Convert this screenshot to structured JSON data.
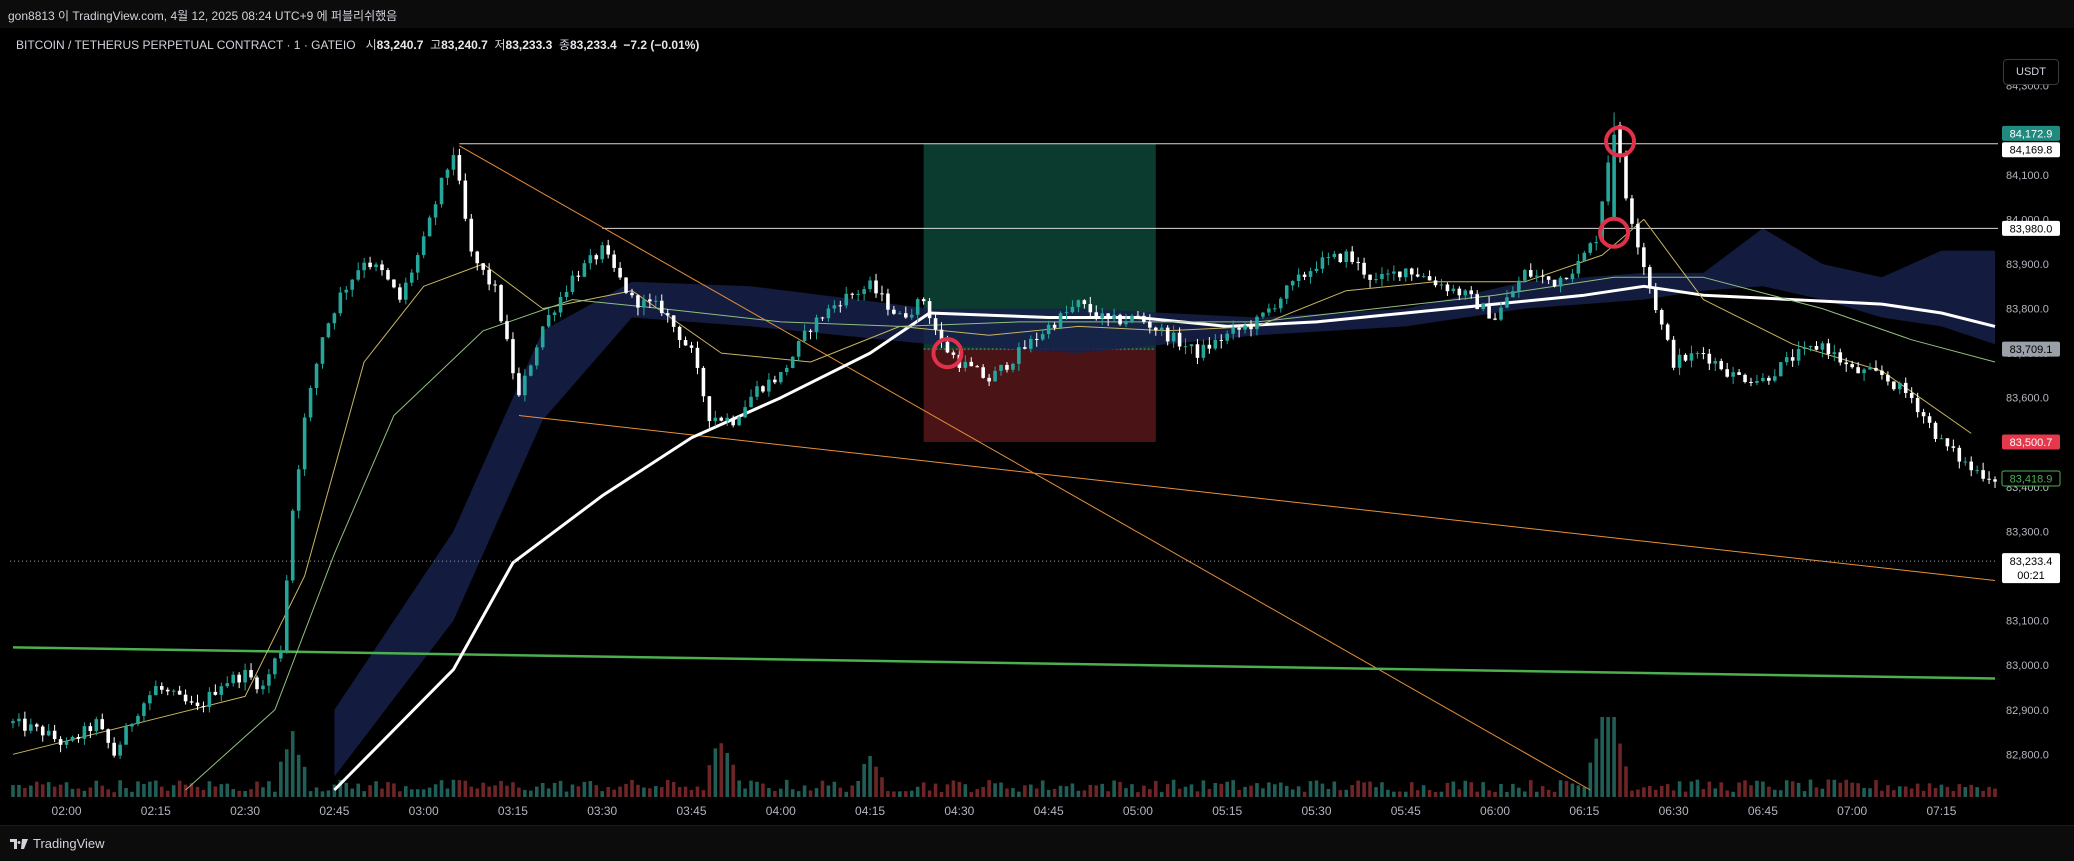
{
  "header": {
    "publish_text": "gon8813 이 TradingView.com, 4월 12, 2025 08:24 UTC+9 에 퍼블리쉬했음"
  },
  "legend": {
    "symbol": "BITCOIN / TETHERUS PERPETUAL CONTRACT · 1 · GATEIO",
    "open_label": "시",
    "open": "83,240.7",
    "high_label": "고",
    "high": "83,240.7",
    "low_label": "저",
    "low": "83,233.3",
    "close_label": "종",
    "close": "83,233.4",
    "change": "−7.2 (−0.01%)"
  },
  "currency_button": "USDT",
  "footer": {
    "brand": "TradingView"
  },
  "colors": {
    "up": "#26a69a",
    "down": "#ef5350",
    "background": "#000000",
    "ma_white": "#ffffff",
    "ma_yellow": "#c8b560",
    "ma_green": "#8fbf7f",
    "ma_red": "#c03030",
    "cloud": "#16204a",
    "trend_orange": "#e8903a",
    "trend_green": "#4caf50",
    "long_profit": "#0b3b2e",
    "long_stop": "#4a1417",
    "circle": "#e0304a"
  },
  "chart_data": {
    "type": "candlestick",
    "symbol": "BITCOIN / TETHERUS PERPETUAL CONTRACT",
    "interval": "1",
    "exchange": "GATEIO",
    "currency": "USDT",
    "ylim": [
      82720,
      84380
    ],
    "y_ticks": [
      82800,
      82900,
      83000,
      83100,
      83200,
      83300,
      83400,
      83500,
      83600,
      83700,
      83800,
      83900,
      84000,
      84100,
      84200,
      84300
    ],
    "y_tick_labels": [
      "82,800.0",
      "82,900.0",
      "83,000.0",
      "83,100.0",
      "83,200.0",
      "83,300.0",
      "83,400.0",
      "83,500.0",
      "83,600.0",
      "83,700.0",
      "83,800.0",
      "83,900.0",
      "84,000.0",
      "84,100.0",
      "84,200.0",
      "84,300.0"
    ],
    "x_tick_labels": [
      "02:00",
      "02:15",
      "02:30",
      "02:45",
      "03:00",
      "03:15",
      "03:30",
      "03:45",
      "04:00",
      "04:15",
      "04:30",
      "04:45",
      "05:00",
      "05:15",
      "05:30",
      "05:45",
      "06:00",
      "06:15",
      "06:30",
      "06:45",
      "07:00",
      "07:15"
    ],
    "time_range": [
      "01:51",
      "07:24"
    ],
    "price_anchors": [
      [
        "01:51",
        82870
      ],
      [
        "01:56",
        82850
      ],
      [
        "02:00",
        82820
      ],
      [
        "02:05",
        82870
      ],
      [
        "02:08",
        82800
      ],
      [
        "02:12",
        82900
      ],
      [
        "02:15",
        82950
      ],
      [
        "02:18",
        82930
      ],
      [
        "02:22",
        82900
      ],
      [
        "02:26",
        82960
      ],
      [
        "02:30",
        82980
      ],
      [
        "02:33",
        82950
      ],
      [
        "02:36",
        83040
      ],
      [
        "02:38",
        83350
      ],
      [
        "02:40",
        83550
      ],
      [
        "02:43",
        83740
      ],
      [
        "02:46",
        83830
      ],
      [
        "02:50",
        83910
      ],
      [
        "02:53",
        83880
      ],
      [
        "02:56",
        83820
      ],
      [
        "03:00",
        83950
      ],
      [
        "03:03",
        84080
      ],
      [
        "03:05",
        84150
      ],
      [
        "03:08",
        83920
      ],
      [
        "03:12",
        83840
      ],
      [
        "03:16",
        83600
      ],
      [
        "03:20",
        83760
      ],
      [
        "03:25",
        83870
      ],
      [
        "03:30",
        83930
      ],
      [
        "03:35",
        83820
      ],
      [
        "03:40",
        83800
      ],
      [
        "03:45",
        83700
      ],
      [
        "03:48",
        83560
      ],
      [
        "03:52",
        83550
      ],
      [
        "03:56",
        83620
      ],
      [
        "04:00",
        83650
      ],
      [
        "04:05",
        83760
      ],
      [
        "04:10",
        83820
      ],
      [
        "04:15",
        83850
      ],
      [
        "04:20",
        83780
      ],
      [
        "04:24",
        83820
      ],
      [
        "04:27",
        83720
      ],
      [
        "04:30",
        83680
      ],
      [
        "04:35",
        83640
      ],
      [
        "04:40",
        83700
      ],
      [
        "04:45",
        83760
      ],
      [
        "04:50",
        83810
      ],
      [
        "04:55",
        83770
      ],
      [
        "05:00",
        83780
      ],
      [
        "05:05",
        83740
      ],
      [
        "05:10",
        83700
      ],
      [
        "05:15",
        83740
      ],
      [
        "05:20",
        83770
      ],
      [
        "05:25",
        83840
      ],
      [
        "05:30",
        83900
      ],
      [
        "05:35",
        83920
      ],
      [
        "05:40",
        83860
      ],
      [
        "05:45",
        83890
      ],
      [
        "05:50",
        83860
      ],
      [
        "05:55",
        83830
      ],
      [
        "06:00",
        83780
      ],
      [
        "06:05",
        83880
      ],
      [
        "06:10",
        83860
      ],
      [
        "06:14",
        83900
      ],
      [
        "06:17",
        83960
      ],
      [
        "06:20",
        84220
      ],
      [
        "06:22",
        84050
      ],
      [
        "06:24",
        83950
      ],
      [
        "06:26",
        83850
      ],
      [
        "06:28",
        83760
      ],
      [
        "06:30",
        83680
      ],
      [
        "06:35",
        83700
      ],
      [
        "06:40",
        83650
      ],
      [
        "06:45",
        83640
      ],
      [
        "06:50",
        83690
      ],
      [
        "06:55",
        83720
      ],
      [
        "07:00",
        83660
      ],
      [
        "07:05",
        83650
      ],
      [
        "07:10",
        83600
      ],
      [
        "07:15",
        83500
      ],
      [
        "07:20",
        83440
      ],
      [
        "07:24",
        83420
      ]
    ],
    "volume_peaks": [
      [
        "04:15",
        3
      ],
      [
        "06:18",
        9
      ],
      [
        "06:20",
        8
      ],
      [
        "03:50",
        6
      ],
      [
        "02:38",
        7
      ]
    ],
    "moving_averages": [
      {
        "color": "#ffffff",
        "points": [
          [
            "02:45",
            82720
          ],
          [
            "03:05",
            82990
          ],
          [
            "03:15",
            83230
          ],
          [
            "03:30",
            83380
          ],
          [
            "03:45",
            83510
          ],
          [
            "04:00",
            83600
          ],
          [
            "04:15",
            83700
          ],
          [
            "04:25",
            83790
          ],
          [
            "04:45",
            83780
          ],
          [
            "05:00",
            83780
          ],
          [
            "05:15",
            83760
          ],
          [
            "05:30",
            83770
          ],
          [
            "05:45",
            83790
          ],
          [
            "06:00",
            83810
          ],
          [
            "06:15",
            83830
          ],
          [
            "06:25",
            83850
          ],
          [
            "06:35",
            83830
          ],
          [
            "06:50",
            83820
          ],
          [
            "07:05",
            83810
          ],
          [
            "07:15",
            83790
          ],
          [
            "07:24",
            83760
          ]
        ]
      },
      {
        "color": "#c8b560",
        "points": [
          [
            "01:51",
            82800
          ],
          [
            "02:15",
            82880
          ],
          [
            "02:30",
            82930
          ],
          [
            "02:40",
            83200
          ],
          [
            "02:50",
            83680
          ],
          [
            "03:00",
            83850
          ],
          [
            "03:10",
            83900
          ],
          [
            "03:20",
            83800
          ],
          [
            "03:35",
            83840
          ],
          [
            "03:50",
            83700
          ],
          [
            "04:05",
            83680
          ],
          [
            "04:20",
            83760
          ],
          [
            "04:35",
            83740
          ],
          [
            "04:50",
            83760
          ],
          [
            "05:05",
            83750
          ],
          [
            "05:20",
            83760
          ],
          [
            "05:35",
            83840
          ],
          [
            "05:50",
            83860
          ],
          [
            "06:05",
            83860
          ],
          [
            "06:18",
            83920
          ],
          [
            "06:25",
            84000
          ],
          [
            "06:35",
            83820
          ],
          [
            "06:50",
            83720
          ],
          [
            "07:05",
            83660
          ],
          [
            "07:20",
            83520
          ]
        ]
      },
      {
        "color": "#8fbf7f",
        "points": [
          [
            "02:20",
            82720
          ],
          [
            "02:35",
            82900
          ],
          [
            "02:45",
            83250
          ],
          [
            "02:55",
            83560
          ],
          [
            "03:10",
            83750
          ],
          [
            "03:25",
            83820
          ],
          [
            "03:40",
            83800
          ],
          [
            "04:00",
            83770
          ],
          [
            "04:20",
            83760
          ],
          [
            "04:40",
            83770
          ],
          [
            "05:00",
            83770
          ],
          [
            "05:20",
            83770
          ],
          [
            "05:40",
            83800
          ],
          [
            "06:00",
            83830
          ],
          [
            "06:20",
            83870
          ],
          [
            "06:35",
            83870
          ],
          [
            "06:55",
            83800
          ],
          [
            "07:10",
            83730
          ],
          [
            "07:24",
            83680
          ]
        ]
      }
    ],
    "cloud": [
      [
        "02:45",
        82750,
        82900
      ],
      [
        "03:05",
        83100,
        83300
      ],
      [
        "03:20",
        83550,
        83750
      ],
      [
        "03:35",
        83780,
        83860
      ],
      [
        "03:55",
        83760,
        83850
      ],
      [
        "04:25",
        83720,
        83800
      ],
      [
        "04:50",
        83700,
        83800
      ],
      [
        "05:20",
        83740,
        83780
      ],
      [
        "05:45",
        83760,
        83800
      ],
      [
        "06:05",
        83800,
        83860
      ],
      [
        "06:25",
        83820,
        83880
      ],
      [
        "06:35",
        83840,
        83880
      ],
      [
        "06:45",
        83850,
        83980
      ],
      [
        "06:55",
        83820,
        83900
      ],
      [
        "07:05",
        83780,
        83870
      ],
      [
        "07:15",
        83760,
        83930
      ],
      [
        "07:24",
        83720,
        83930
      ]
    ],
    "trend_lines": [
      {
        "color": "#e8903a",
        "from": [
          "03:06",
          84165
        ],
        "to": [
          "06:16",
          82720
        ]
      },
      {
        "color": "#e8903a",
        "from": [
          "03:16",
          83560
        ],
        "to": [
          "07:24",
          83190
        ]
      },
      {
        "color": "#4caf50",
        "from": [
          "01:51",
          83040
        ],
        "to": [
          "07:24",
          82970
        ]
      }
    ],
    "horizontal_lines": [
      {
        "price": 84169.8,
        "from": "03:06",
        "label": "84,169.8"
      },
      {
        "price": 83980.0,
        "from": "03:30",
        "label": "83,980.0"
      }
    ],
    "long_position": {
      "start": "04:24",
      "end": "05:03",
      "entry": 83709.1,
      "target": 84169.8,
      "stop": 83500.7
    },
    "circles": [
      [
        "04:28",
        83700
      ],
      [
        "06:20",
        83970
      ],
      [
        "06:21",
        84175
      ]
    ],
    "price_labels": [
      {
        "text": "84,172.9",
        "price": 84172.9,
        "style": "teal"
      },
      {
        "text": "84,169.8",
        "price": 84169.8,
        "style": "outline"
      },
      {
        "text": "83,980.0",
        "price": 83980.0,
        "style": "outline"
      },
      {
        "text": "83,709.1",
        "price": 83709.1,
        "style": "grey"
      },
      {
        "text": "83,500.7",
        "price": 83500.7,
        "style": "red"
      },
      {
        "text": "83,418.9",
        "price": 83418.9,
        "style": "green-outline"
      }
    ],
    "last_price": {
      "text": "83,233.4",
      "countdown": "00:21",
      "price": 83233.4
    }
  }
}
